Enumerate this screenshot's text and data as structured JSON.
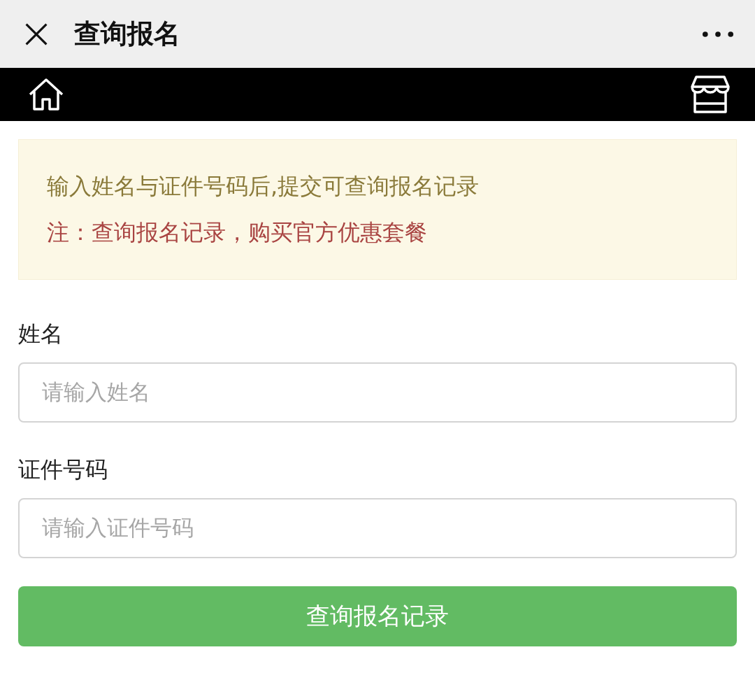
{
  "header": {
    "title": "查询报名"
  },
  "notice": {
    "lines": [
      {
        "kind": "info",
        "text": "输入姓名与证件号码后,提交可查询报名记录"
      },
      {
        "kind": "warning",
        "text": "注：查询报名记录，购买官方优惠套餐"
      }
    ]
  },
  "fields": [
    {
      "label": "姓名",
      "placeholder": "请输入姓名"
    },
    {
      "label": "证件号码",
      "placeholder": "请输入证件号码"
    }
  ],
  "submit": {
    "label": "查询报名记录"
  }
}
